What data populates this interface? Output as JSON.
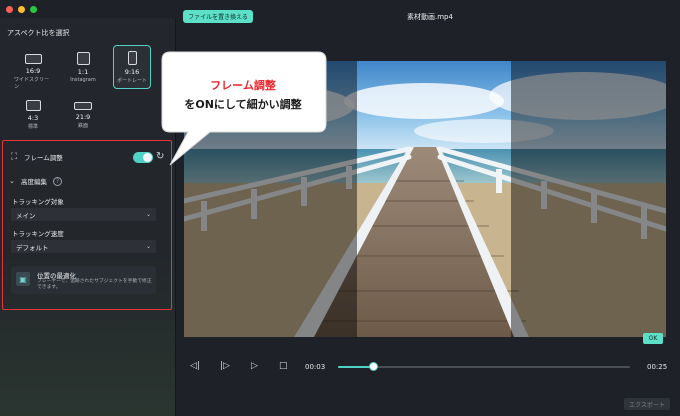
{
  "window": {
    "title": "素材動画.mp4"
  },
  "header": {
    "replace_file_label": "ファイルを置き換える"
  },
  "sidebar": {
    "title": "アスペクト比を選択",
    "ratios": [
      {
        "label": "16:9",
        "sub": "ワイドスクリーン",
        "selected": false
      },
      {
        "label": "1:1",
        "sub": "Instagram",
        "selected": false
      },
      {
        "label": "9:16",
        "sub": "ポートレート",
        "selected": true
      },
      {
        "label": "4:3",
        "sub": "標準",
        "selected": false
      },
      {
        "label": "21:9",
        "sub": "鉄面",
        "selected": false
      }
    ],
    "frame_adjust": {
      "label": "フレーム調整",
      "enabled": true
    },
    "advanced": {
      "label": "高度編集",
      "tracking_target_label": "トラッキング対象",
      "tracking_target_value": "メイン",
      "tracking_speed_label": "トラッキング速度",
      "tracking_speed_value": "デフォルト"
    },
    "tip": {
      "title": "位置の最適化",
      "desc": "プレーヤーで、追跡されたサブジェクトを手動で修正できます。"
    }
  },
  "callout": {
    "line1": "フレーム調整",
    "line2": "をONにして細かい調整"
  },
  "player": {
    "current_time": "00:03",
    "total_time": "00:25",
    "progress": 0.12,
    "ok_label": "OK",
    "export_label": "エクスポート"
  },
  "colors": {
    "accent": "#4fd1c5",
    "highlight_red": "#e8343c"
  },
  "icons": [
    "crop-icon",
    "reset-icon",
    "chevron-down-icon",
    "help-icon",
    "prev-frame-icon",
    "next-frame-icon",
    "play-icon",
    "stop-icon",
    "optimize-icon"
  ]
}
